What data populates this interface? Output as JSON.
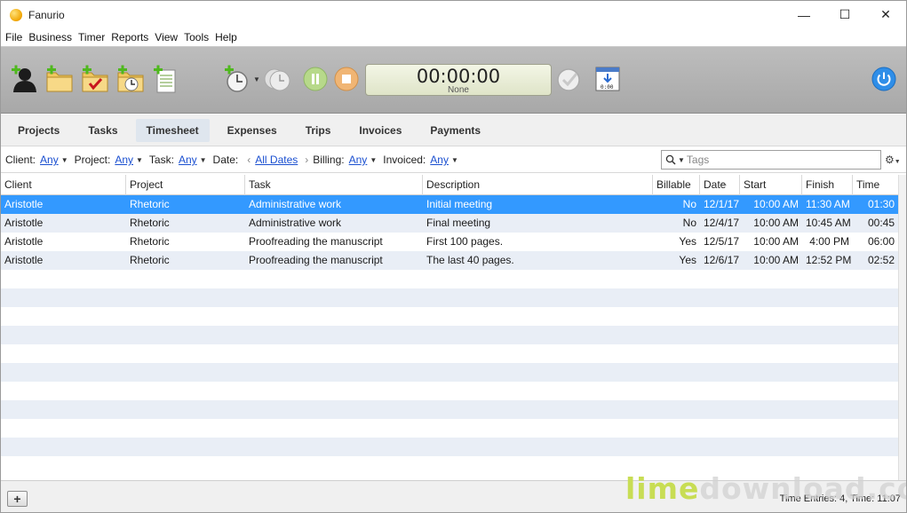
{
  "window": {
    "title": "Fanurio",
    "controls": [
      "—",
      "☐",
      "✕"
    ]
  },
  "menu": [
    "File",
    "Business",
    "Timer",
    "Reports",
    "View",
    "Tools",
    "Help"
  ],
  "toolbar": {
    "timer_value": "00:00:00",
    "timer_label": "None",
    "icons": [
      "add-client-icon",
      "add-project-icon",
      "add-task-icon",
      "add-timed-task-icon",
      "add-document-icon",
      "new-timer-icon",
      "timer-menu-icon",
      "pause-icon",
      "stop-icon",
      "finish-icon",
      "export-time-icon",
      "power-icon"
    ]
  },
  "tabs": [
    "Projects",
    "Tasks",
    "Timesheet",
    "Expenses",
    "Trips",
    "Invoices",
    "Payments"
  ],
  "active_tab": "Timesheet",
  "filters": {
    "client_label": "Client:",
    "client_value": "Any",
    "project_label": "Project:",
    "project_value": "Any",
    "task_label": "Task:",
    "task_value": "Any",
    "date_label": "Date:",
    "date_value": "All Dates",
    "billing_label": "Billing:",
    "billing_value": "Any",
    "invoiced_label": "Invoiced:",
    "invoiced_value": "Any",
    "tags_placeholder": "Tags"
  },
  "table": {
    "columns": [
      "Client",
      "Project",
      "Task",
      "Description",
      "Billable",
      "Date",
      "Start",
      "Finish",
      "Time"
    ],
    "rows": [
      [
        "Aristotle",
        "Rhetoric",
        "Administrative work",
        "Initial meeting",
        "No",
        "12/1/17",
        "10:00 AM",
        "11:30 AM",
        "01:30"
      ],
      [
        "Aristotle",
        "Rhetoric",
        "Administrative work",
        "Final meeting",
        "No",
        "12/4/17",
        "10:00 AM",
        "10:45 AM",
        "00:45"
      ],
      [
        "Aristotle",
        "Rhetoric",
        "Proofreading the manuscript",
        "First 100 pages.",
        "Yes",
        "12/5/17",
        "10:00 AM",
        "4:00 PM",
        "06:00"
      ],
      [
        "Aristotle",
        "Rhetoric",
        "Proofreading the manuscript",
        "The last 40 pages.",
        "Yes",
        "12/6/17",
        "10:00 AM",
        "12:52 PM",
        "02:52"
      ]
    ],
    "selected_row": 0
  },
  "footer": {
    "add_label": "+",
    "status": "Time Entries: 4,  Time: 11:07"
  },
  "watermark": {
    "lime": "lime",
    "rest": "download.com"
  },
  "colors": {
    "selection": "#3399ff",
    "link": "#1a4fd0",
    "alt_row": "#e9eef6"
  }
}
